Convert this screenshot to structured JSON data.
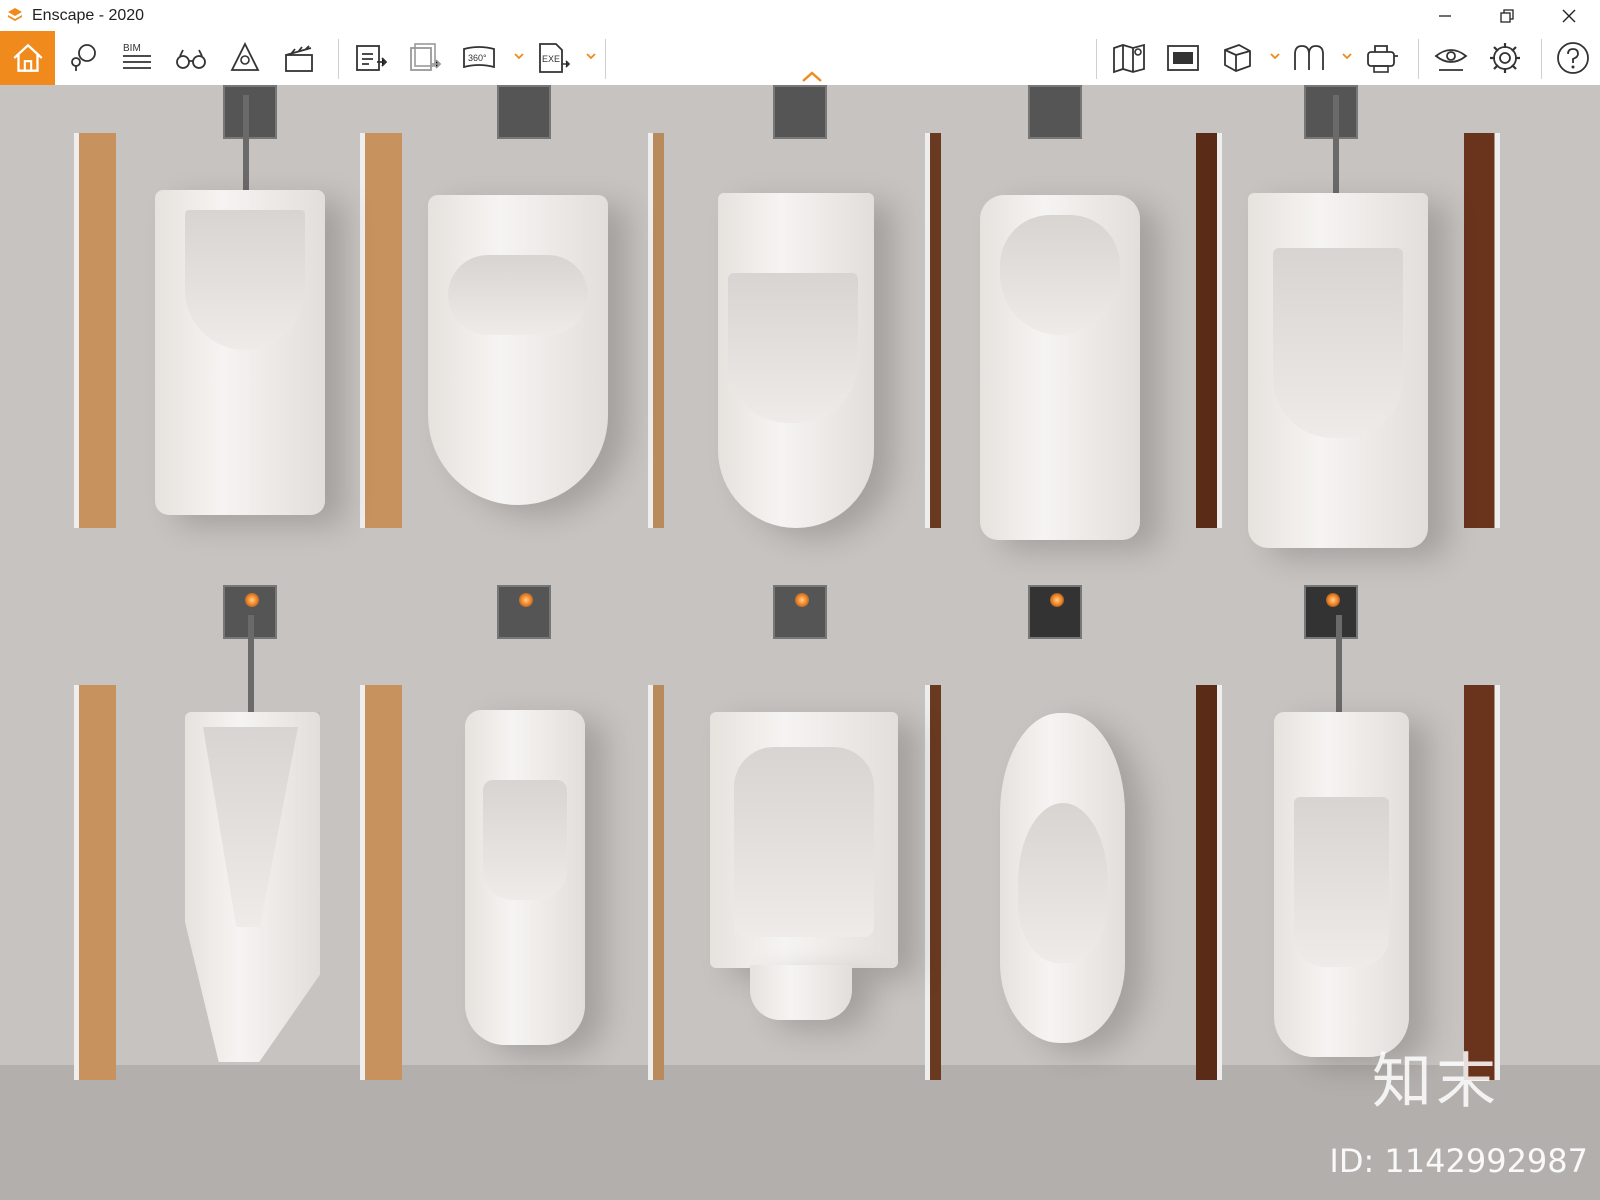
{
  "window": {
    "title": "Enscape - 2020"
  },
  "toolbar": {
    "bim_label": "BIM",
    "panorama_label": "360°",
    "exe_label": "EXE"
  },
  "icons": [
    "home-icon",
    "chat-pin-icon",
    "bim-icon",
    "binoculars-icon",
    "bell-cone-icon",
    "clapperboard-icon",
    "screenshot-export-icon",
    "batch-render-icon",
    "panorama-icon",
    "exe-export-icon",
    "map-icon",
    "asset-library-icon",
    "cube-icon",
    "atmosphere-icon",
    "vr-headset-icon",
    "visual-settings-icon",
    "settings-gear-icon",
    "help-icon"
  ],
  "watermark": {
    "logo": "知末",
    "id": "ID: 1142992987"
  },
  "colors": {
    "accent": "#f08a1c"
  }
}
